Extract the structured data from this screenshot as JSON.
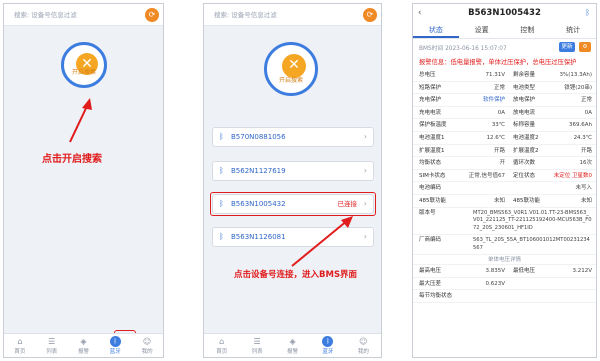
{
  "colors": {
    "accent": "#3d7de0",
    "note": "#e01c1c",
    "warn": "#f5a623"
  },
  "search_placeholder": "搜索: 设备号信息过滤",
  "search_button_icon": "⟳",
  "scan_icon": "✕",
  "scan_label": "开启搜索",
  "note1": "点击开启搜索",
  "note2": "点击设备号连接，进入BMS界面",
  "devices": [
    {
      "name": "B570N0881056",
      "status": ""
    },
    {
      "name": "B562N1127619",
      "status": ""
    },
    {
      "name": "B563N1005432",
      "status": "已连接"
    },
    {
      "name": "B563N1126081",
      "status": ""
    }
  ],
  "tabs": [
    {
      "icon": "⌂",
      "label": "首页"
    },
    {
      "icon": "☰",
      "label": "列表"
    },
    {
      "icon": "◈",
      "label": "报警"
    },
    {
      "icon": "ᛒ",
      "label": "蓝牙"
    },
    {
      "icon": "☺",
      "label": "我的"
    }
  ],
  "bms": {
    "title": "B563N1005432",
    "back": "‹",
    "bt_icon": "ᛒ",
    "tabs": [
      "状态",
      "设置",
      "控制",
      "统计"
    ],
    "time": "BMS时间 2023-06-16 15:07:07",
    "btn1": "更新",
    "alarm": "报警信息：低电量报警，单体过压保护，总电压过压保护",
    "rows": [
      [
        "总电压",
        "71.31V",
        "剩余容量",
        "3%(13.3Ah)"
      ],
      [
        "短路保护",
        "正常",
        "电池类型",
        "铁锂(20串)"
      ],
      [
        "充电保护",
        "软件保护",
        "放电保护",
        "正常"
      ],
      [
        "充电电流",
        "0A",
        "放电电流",
        "0A"
      ],
      [
        "保护板温度",
        "33℃",
        "标称容量",
        "369.6Ah"
      ],
      [
        "电池温度1",
        "12.6℃",
        "电池温度2",
        "24.3℃"
      ],
      [
        "扩展温度1",
        "开路",
        "扩展温度2",
        "开路"
      ],
      [
        "均衡状态",
        "开",
        "循环次数",
        "16次"
      ],
      [
        "SIM卡状态",
        "正常,信号值67",
        "定位状态",
        "未定位 卫星数0"
      ]
    ],
    "single": [
      [
        "电池编码",
        "未写入"
      ],
      [
        "485联功能",
        "未知",
        "485联功能",
        "未知"
      ]
    ],
    "version_label": "版本号",
    "version": "MT20_BMS563_V0R1.V01.01.TT-23-BMS563_V01_221125_TT-221125192400-MCU563B_F072_20S_230601_HF1ID",
    "vendor_label": "厂商编码",
    "vendor": "563_TL_20S_55A_BT106001012MT00231234567",
    "section": "单体电压详情",
    "cells": [
      [
        "最高电压",
        "3.835V",
        "最低电压",
        "3.212V"
      ],
      [
        "最大压差",
        "0.623V",
        "",
        ""
      ],
      [
        "每节均衡状态",
        "",
        "",
        ""
      ]
    ]
  }
}
